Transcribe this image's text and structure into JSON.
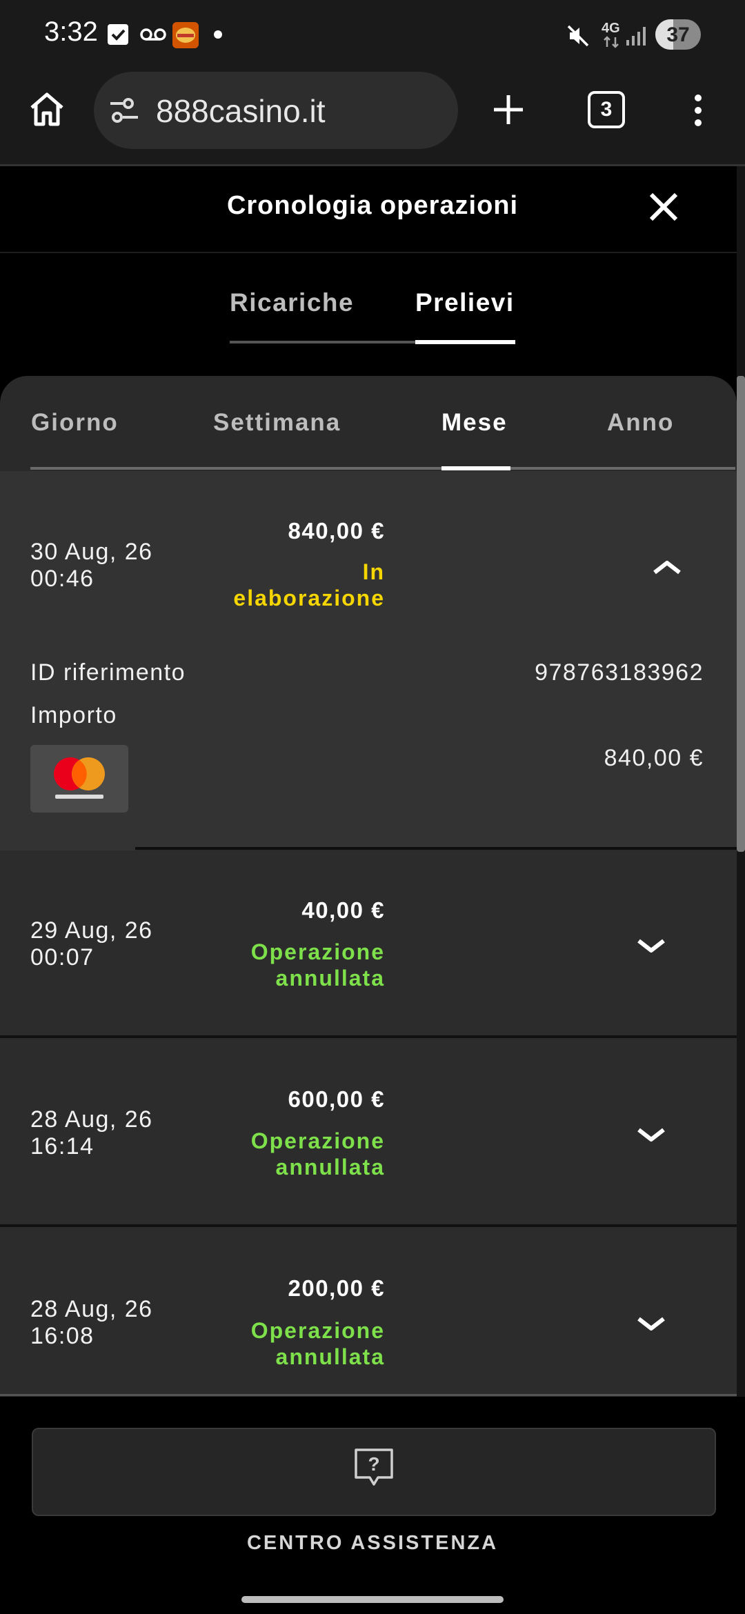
{
  "status_bar": {
    "time": "3:32",
    "network": "4G",
    "battery": "37",
    "icons": [
      "checkbox-icon",
      "voicemail-icon",
      "burger-king-app-icon",
      "dot-icon",
      "mute-icon",
      "signal-icon",
      "battery-icon"
    ]
  },
  "browser": {
    "url": "888casino.it",
    "tab_count": "3",
    "icons": [
      "home-icon",
      "site-settings-icon",
      "new-tab-icon",
      "tabs-icon",
      "more-menu-icon"
    ]
  },
  "page": {
    "title": "Cronologia operazioni",
    "tabs": [
      {
        "label": "Ricariche",
        "active": false
      },
      {
        "label": "Prelievi",
        "active": true
      }
    ],
    "periods": [
      {
        "label": "Giorno",
        "active": false
      },
      {
        "label": "Settimana",
        "active": false
      },
      {
        "label": "Mese",
        "active": true
      },
      {
        "label": "Anno",
        "active": false
      }
    ],
    "transactions": [
      {
        "date": "30 Aug, 26",
        "time": "00:46",
        "amount": "840,00 €",
        "status_line1": "In",
        "status_line2": "elaborazione",
        "status_color": "#f5d600",
        "expanded": true,
        "details": {
          "ref_label": "ID riferimento",
          "ref_value": "978763183962",
          "amount_label": "Importo",
          "amount_value": "840,00 €",
          "method": "mastercard"
        }
      },
      {
        "date": "29 Aug, 26",
        "time": "00:07",
        "amount": "40,00 €",
        "status_line1": "Operazione",
        "status_line2": "annullata",
        "status_color": "#7ee04a",
        "expanded": false
      },
      {
        "date": "28 Aug, 26",
        "time": "16:14",
        "amount": "600,00 €",
        "status_line1": "Operazione",
        "status_line2": "annullata",
        "status_color": "#7ee04a",
        "expanded": false
      },
      {
        "date": "28 Aug, 26",
        "time": "16:08",
        "amount": "200,00 €",
        "status_line1": "Operazione",
        "status_line2": "annullata",
        "status_color": "#7ee04a",
        "expanded": false
      }
    ],
    "help": {
      "label": "CENTRO ASSISTENZA",
      "icon": "help-bubble-icon"
    }
  },
  "colors": {
    "background": "#000000",
    "panel": "#2c2c2c",
    "pending": "#f5d600",
    "cancelled": "#7ee04a"
  }
}
